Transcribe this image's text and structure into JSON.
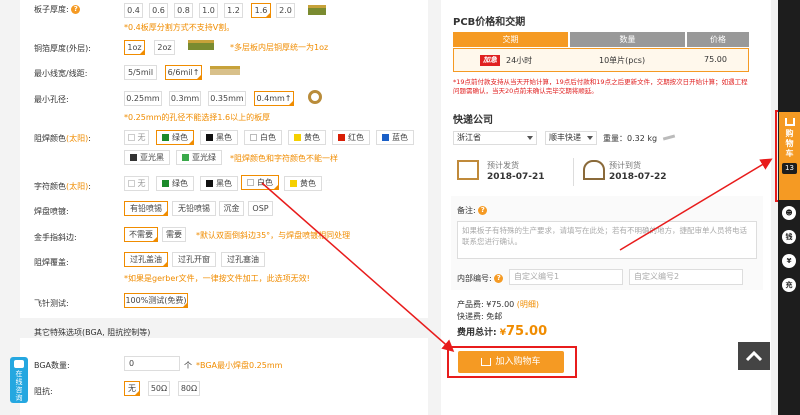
{
  "left": {
    "board_thickness": {
      "label": "板子厚度:",
      "options": [
        "0.4",
        "0.6",
        "0.8",
        "1.0",
        "1.2",
        "1.6",
        "2.0"
      ],
      "selected": "1.6",
      "note": "*0.4板厚分割方式不支持V割。"
    },
    "copper_thickness": {
      "label": "铜箔厚度(外层):",
      "options": [
        "1oz",
        "2oz"
      ],
      "selected": "1oz",
      "note": "*多层板内层铜厚统一为1oz"
    },
    "min_trace": {
      "label": "最小线宽/线距:",
      "options": [
        "5/5mil",
        "6/6mil↑"
      ],
      "selected": "6/6mil↑"
    },
    "min_hole": {
      "label": "最小孔径:",
      "options": [
        "0.25mm",
        "0.3mm",
        "0.35mm",
        "0.4mm↑"
      ],
      "selected": "0.4mm↑",
      "note": "*0.25mm的孔径不能选择1.6以上的板厚"
    },
    "solder_mask": {
      "label": "阻焊颜色",
      "sun": "(太阳)",
      "colon": ":",
      "row1": [
        {
          "name": "无",
          "color": "#ffffff"
        },
        {
          "name": "绿色",
          "color": "#1b8a2a"
        },
        {
          "name": "黑色",
          "color": "#111111"
        },
        {
          "name": "白色",
          "color": "#ffffff"
        },
        {
          "name": "黄色",
          "color": "#f5d000"
        },
        {
          "name": "红色",
          "color": "#d81e06"
        },
        {
          "name": "蓝色",
          "color": "#1a5fc7"
        }
      ],
      "row2": [
        {
          "name": "亚光黑",
          "color": "#333333"
        },
        {
          "name": "亚光绿",
          "color": "#3aa94a"
        }
      ],
      "selected": "绿色",
      "note": "*阻焊颜色和字符颜色不能一样"
    },
    "silkscreen": {
      "label": "字符颜色",
      "sun": "(太阳)",
      "colon": ":",
      "options": [
        {
          "name": "无",
          "color": "#ffffff"
        },
        {
          "name": "绿色",
          "color": "#1b8a2a"
        },
        {
          "name": "黑色",
          "color": "#111111"
        },
        {
          "name": "白色",
          "color": "#ffffff"
        },
        {
          "name": "黄色",
          "color": "#f5d000"
        }
      ],
      "selected": "白色"
    },
    "pad_finish": {
      "label": "焊盘喷镀:",
      "options": [
        "有铅喷锡",
        "无铅喷锡",
        "沉金",
        "OSP"
      ],
      "selected": "有铅喷锡"
    },
    "gold_bevel": {
      "label": "金手指斜边:",
      "options": [
        "不需要",
        "需要"
      ],
      "selected": "不需要",
      "note": "*默认双面倒斜边35°，与焊盘喷镀相同处理"
    },
    "via_cover": {
      "label": "阻焊覆盖:",
      "options": [
        "过孔盖油",
        "过孔开窗",
        "过孔塞油"
      ],
      "selected": "过孔盖油",
      "note": "*如果是gerber文件，一律按文件加工，此选项无效!"
    },
    "flying_probe": {
      "label": "飞针测试:",
      "options": [
        "100%测试(免费)"
      ],
      "selected": "100%测试(免费)"
    },
    "special_header": "其它特殊选项(BGA, 阻抗控制等)",
    "bga": {
      "label": "BGA数量:",
      "value": "0",
      "unit": "个",
      "note": "*BGA最小焊盘0.25mm"
    },
    "impedance": {
      "label": "阻抗:",
      "options": [
        "无",
        "50Ω",
        "80Ω"
      ],
      "selected": "无"
    },
    "online_chat": "在线咨询"
  },
  "right": {
    "price_title": "PCB价格和交期",
    "table_headers": [
      "交期",
      "数量",
      "价格"
    ],
    "table_row": {
      "badge": "加急",
      "delivery": "24小时",
      "qty": "10单片(pcs)",
      "price": "75.00"
    },
    "rule_note": "*19点前付款支持从当天开始计算，19点后付款和19点之后更新文件，交期按次日开始计算；如遇工程问题需确认，当天20点前未确认完毕交期将顺延。",
    "express_title": "快递公司",
    "province": "浙江省",
    "courier": "顺丰快递",
    "weight_label": "重量：",
    "weight": "0.32 kg",
    "ship_label": "预计发货",
    "ship_date": "2018-07-21",
    "arrive_label": "预计到货",
    "arrive_date": "2018-07-22",
    "remark_label": "备注:",
    "remark_placeholder": "如果板子有特殊的生产要求，请填写在此处；若有不明确的地方，捷配审单人员将电话联系您进行确认。",
    "inner_code_label": "内部编号:",
    "inner_code1_placeholder": "自定义编号1",
    "inner_code2_placeholder": "自定义编号2",
    "product_fee_label": "产品费:",
    "product_fee": "¥75.00",
    "detail_link": "(明细)",
    "shipping_label": "快递费:",
    "shipping_fee": "免邮",
    "total_label": "费用总计:",
    "total_currency": "¥",
    "total": "75.00",
    "add_cart": "加入购物车"
  },
  "sidebar": {
    "cart_label": "购物车",
    "cart_count": "13",
    "icons": [
      "钱",
      "¥",
      "充"
    ]
  }
}
